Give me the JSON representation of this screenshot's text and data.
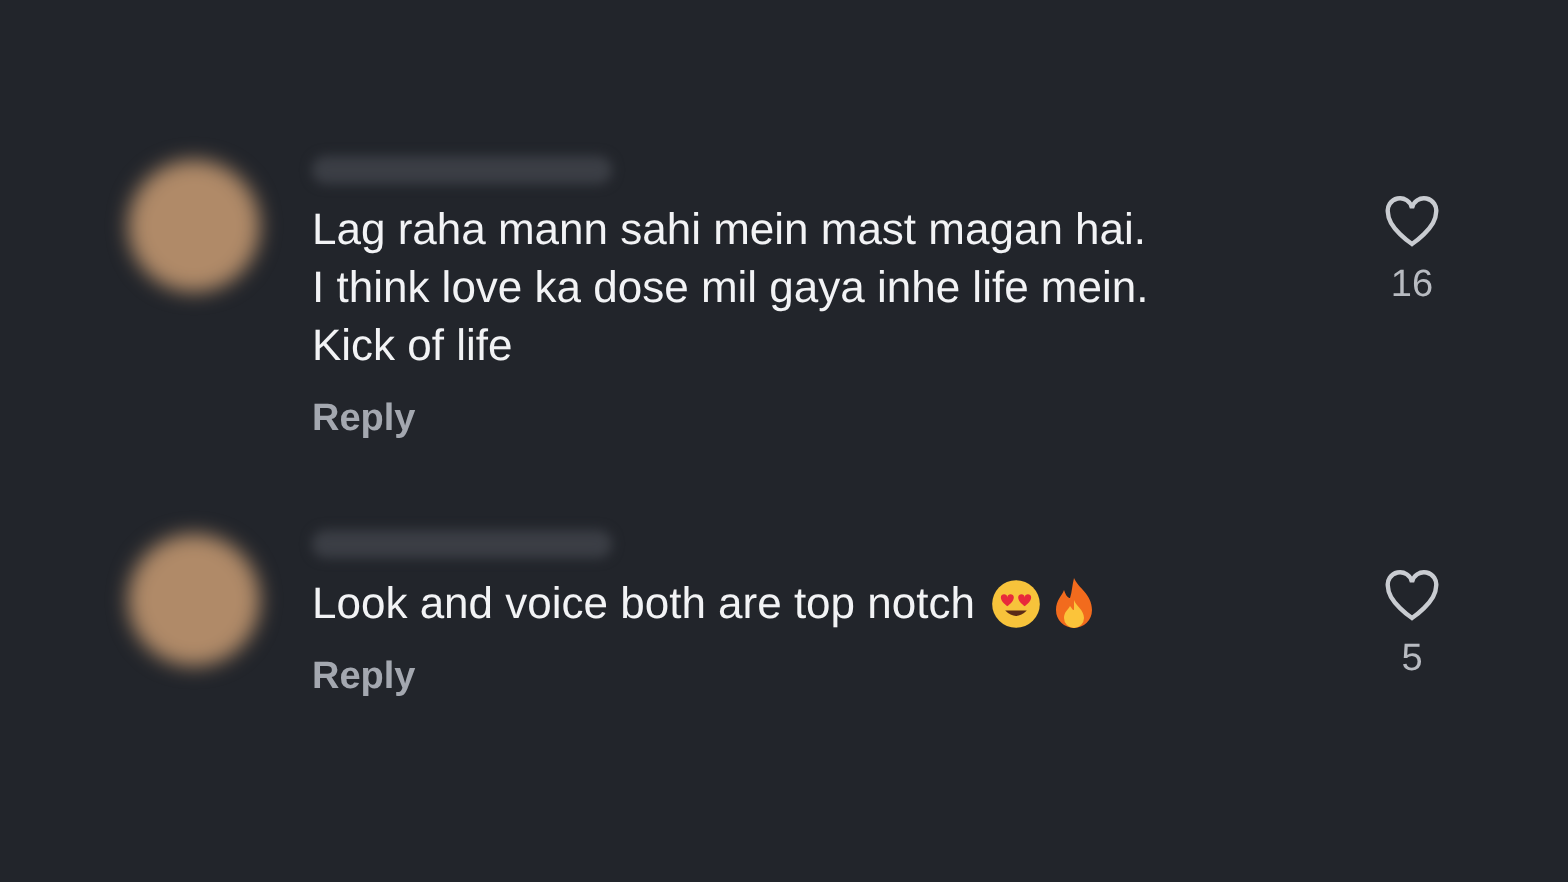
{
  "comments": [
    {
      "text": "Lag raha mann sahi mein mast magan hai.\nI think love ka dose mil gaya inhe life mein.\nKick of life",
      "reply": "Reply",
      "likes": "16",
      "liked": false
    },
    {
      "text": "Look and voice both are top notch",
      "icons": [
        {
          "kind": "heart-eyes"
        },
        {
          "kind": "fire"
        }
      ],
      "reply": "Reply",
      "likes": "5",
      "liked": false
    }
  ]
}
